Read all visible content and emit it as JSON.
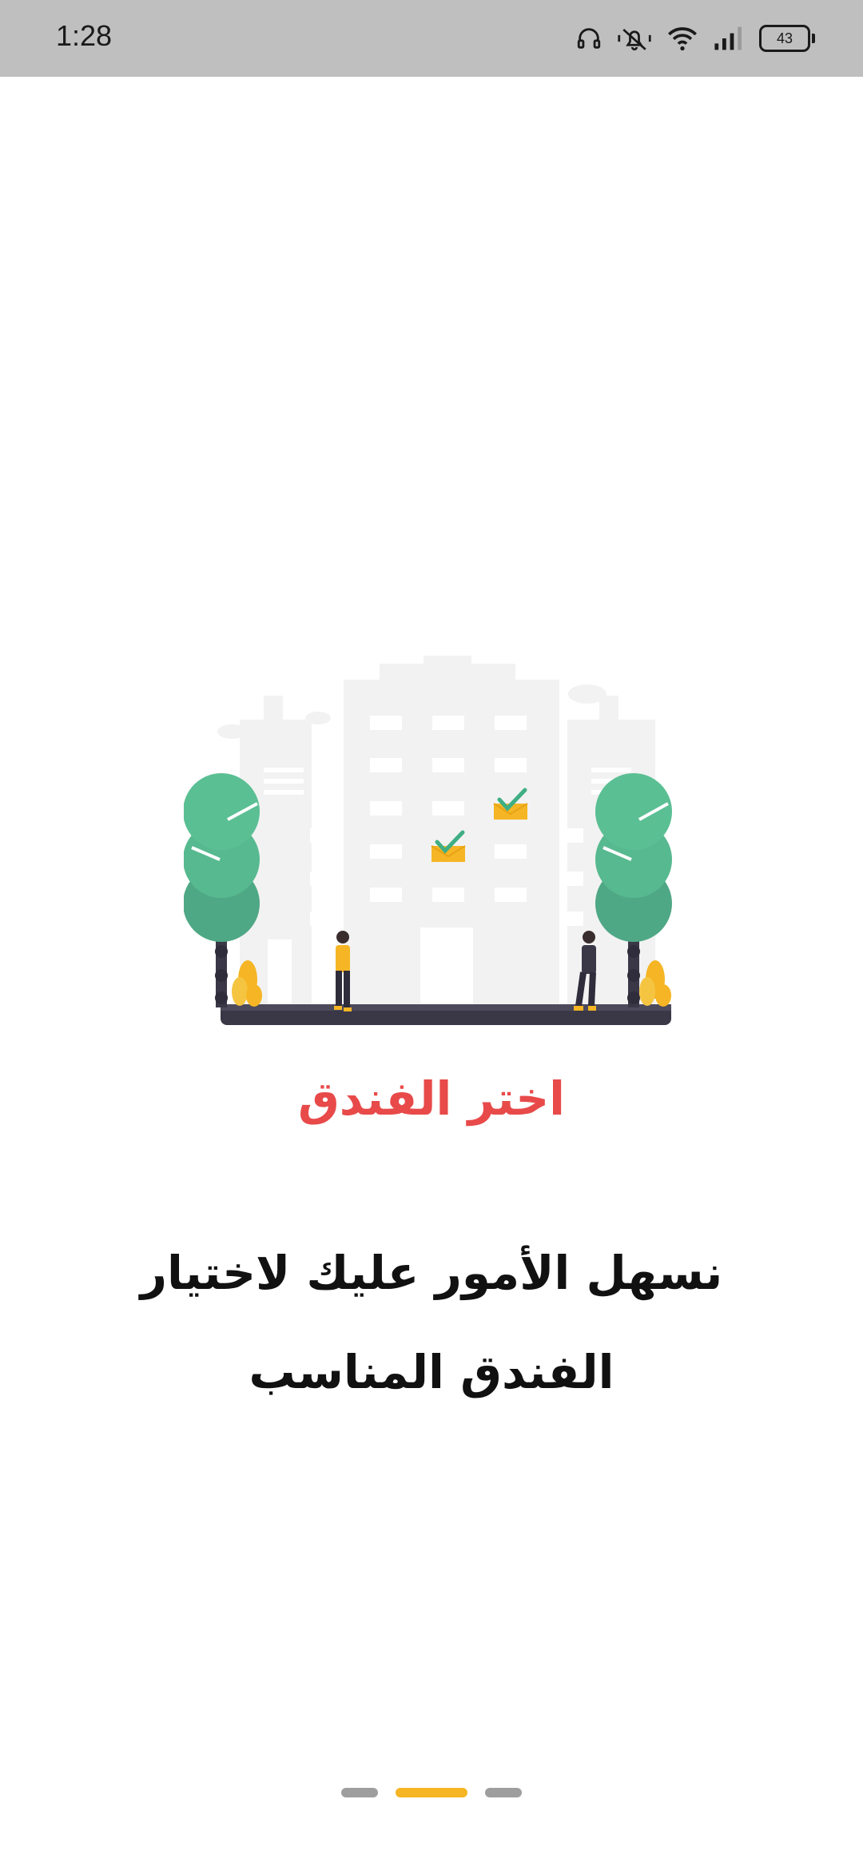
{
  "status_bar": {
    "time": "1:28",
    "battery": "43",
    "icons": [
      "headphones-icon",
      "silent-bell-icon",
      "wifi-icon",
      "signal-icon",
      "battery-icon"
    ]
  },
  "onboarding": {
    "title": "اختر الفندق",
    "subtitle": "نسهل الأمور عليك لاختيار الفندق المناسب",
    "pages_total": 3,
    "active_page": 2
  },
  "colors": {
    "title": "#e84a4a",
    "accent": "#f5b524",
    "tree": "#57b98f",
    "check": "#3fae84",
    "status_bar": "#bfbfbf"
  }
}
